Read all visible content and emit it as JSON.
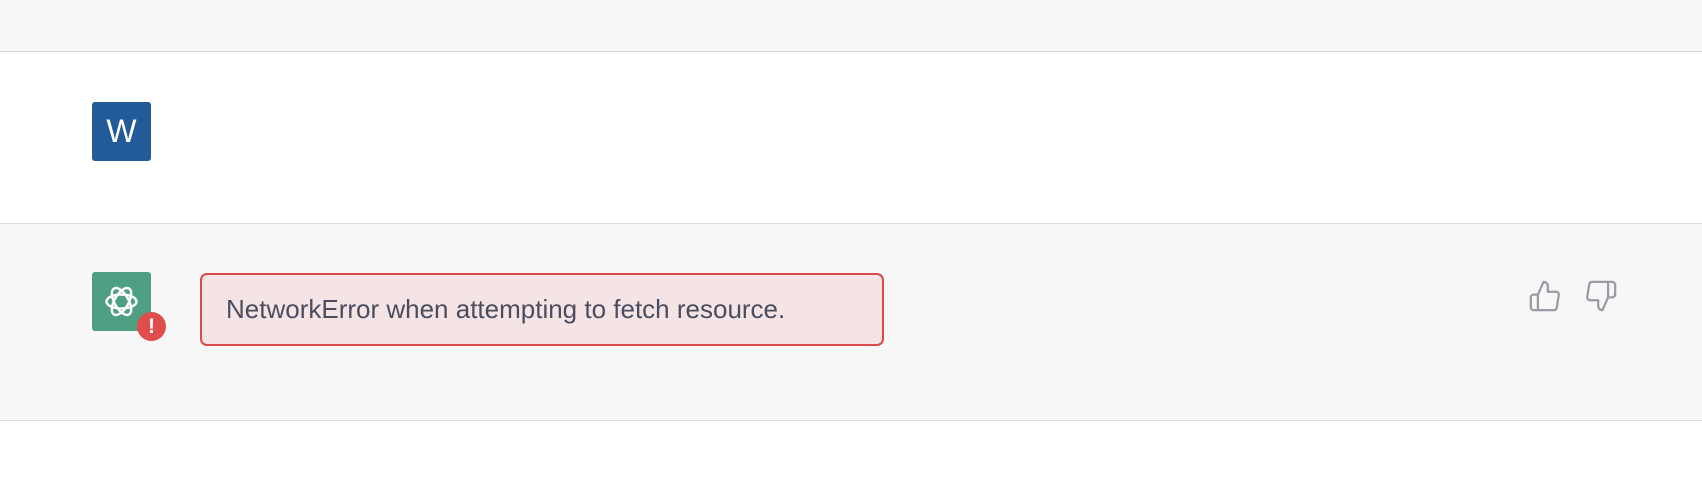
{
  "user_message": {
    "avatar_letter": "W",
    "avatar_color": "#235a98",
    "text": "",
    "blurred": true
  },
  "assistant_message": {
    "avatar_icon": "openai-logo-icon",
    "avatar_color": "#4f9f82",
    "badge_text": "!",
    "badge_color": "#df4d4d",
    "error_text": "NetworkError when attempting to fetch resource.",
    "error_border_color": "#dc4a4a",
    "error_bg_color": "#f4e4e6",
    "feedback": {
      "thumbs_up_icon": "thumbs-up-icon",
      "thumbs_down_icon": "thumbs-down-icon"
    }
  }
}
